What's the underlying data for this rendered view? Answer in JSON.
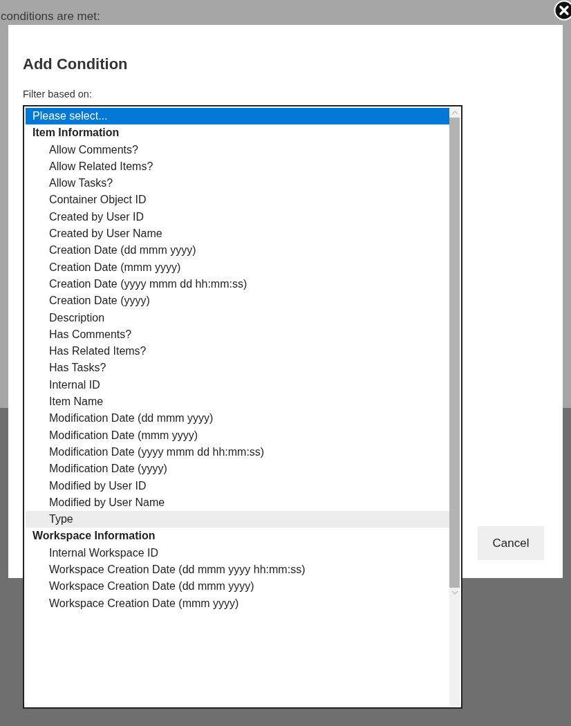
{
  "background_text": "conditions are met:",
  "dialog": {
    "title": "Add Condition",
    "filter_label": "Filter based on:",
    "cancel_button": "Cancel"
  },
  "listbox": {
    "options": [
      {
        "kind": "option",
        "label": "Please select...",
        "selected": true,
        "hovered": false
      },
      {
        "kind": "group",
        "label": "Item Information",
        "children": [
          {
            "kind": "option",
            "label": "Allow Comments?",
            "selected": false,
            "hovered": false
          },
          {
            "kind": "option",
            "label": "Allow Related Items?",
            "selected": false,
            "hovered": false
          },
          {
            "kind": "option",
            "label": "Allow Tasks?",
            "selected": false,
            "hovered": false
          },
          {
            "kind": "option",
            "label": "Container Object ID",
            "selected": false,
            "hovered": false
          },
          {
            "kind": "option",
            "label": "Created by User ID",
            "selected": false,
            "hovered": false
          },
          {
            "kind": "option",
            "label": "Created by User Name",
            "selected": false,
            "hovered": false
          },
          {
            "kind": "option",
            "label": "Creation Date (dd mmm yyyy)",
            "selected": false,
            "hovered": false
          },
          {
            "kind": "option",
            "label": "Creation Date (mmm yyyy)",
            "selected": false,
            "hovered": false
          },
          {
            "kind": "option",
            "label": "Creation Date (yyyy mmm dd hh:mm:ss)",
            "selected": false,
            "hovered": false
          },
          {
            "kind": "option",
            "label": "Creation Date (yyyy)",
            "selected": false,
            "hovered": false
          },
          {
            "kind": "option",
            "label": "Description",
            "selected": false,
            "hovered": false
          },
          {
            "kind": "option",
            "label": "Has Comments?",
            "selected": false,
            "hovered": false
          },
          {
            "kind": "option",
            "label": "Has Related Items?",
            "selected": false,
            "hovered": false
          },
          {
            "kind": "option",
            "label": "Has Tasks?",
            "selected": false,
            "hovered": false
          },
          {
            "kind": "option",
            "label": "Internal ID",
            "selected": false,
            "hovered": false
          },
          {
            "kind": "option",
            "label": "Item Name",
            "selected": false,
            "hovered": false
          },
          {
            "kind": "option",
            "label": "Modification Date (dd mmm yyyy)",
            "selected": false,
            "hovered": false
          },
          {
            "kind": "option",
            "label": "Modification Date (mmm yyyy)",
            "selected": false,
            "hovered": false
          },
          {
            "kind": "option",
            "label": "Modification Date (yyyy mmm dd hh:mm:ss)",
            "selected": false,
            "hovered": false
          },
          {
            "kind": "option",
            "label": "Modification Date (yyyy)",
            "selected": false,
            "hovered": false
          },
          {
            "kind": "option",
            "label": "Modified by User ID",
            "selected": false,
            "hovered": false
          },
          {
            "kind": "option",
            "label": "Modified by User Name",
            "selected": false,
            "hovered": false
          },
          {
            "kind": "option",
            "label": "Type",
            "selected": false,
            "hovered": true
          }
        ]
      },
      {
        "kind": "group",
        "label": "Workspace Information",
        "children": [
          {
            "kind": "option",
            "label": "Internal Workspace ID",
            "selected": false,
            "hovered": false
          },
          {
            "kind": "option",
            "label": "Workspace Creation Date (dd mmm yyyy hh:mm:ss)",
            "selected": false,
            "hovered": false
          },
          {
            "kind": "option",
            "label": "Workspace Creation Date (dd mmm yyyy)",
            "selected": false,
            "hovered": false
          },
          {
            "kind": "option",
            "label": "Workspace Creation Date (mmm yyyy)",
            "selected": false,
            "hovered": false
          }
        ]
      }
    ]
  }
}
